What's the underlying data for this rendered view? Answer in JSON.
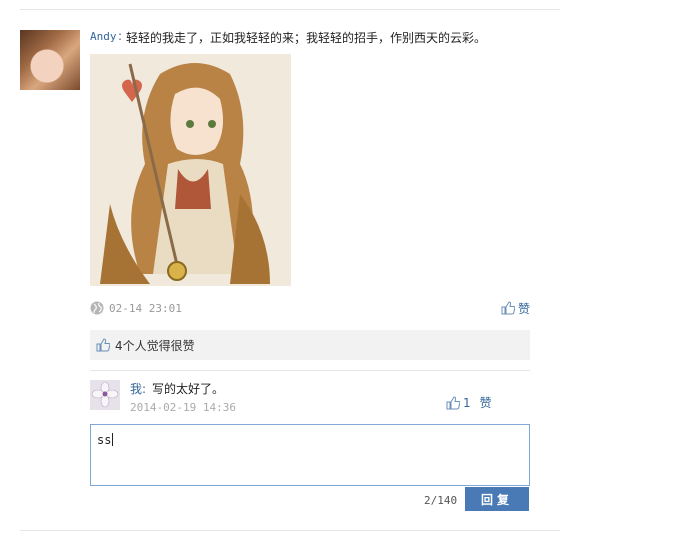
{
  "post": {
    "author": "Andy",
    "separator": ":",
    "text": "轻轻的我走了，正如我轻轻的来；我轻轻的招手，作别西天的云彩。",
    "time": "02-14 23:01",
    "like_label": "赞",
    "likes_summary": "4个人觉得很赞"
  },
  "reply": {
    "author": "我",
    "separator": ":",
    "text": "写的太好了。",
    "time": "2014-02-19 14:36",
    "like_count": "1",
    "like_label": "赞"
  },
  "composer": {
    "value": "ss",
    "counter": "2/140",
    "submit_label": "回复"
  },
  "colors": {
    "link": "#336699",
    "button": "#4a7ab5",
    "input_border": "#7fa8d6"
  },
  "icons": [
    "globe-icon",
    "thumbs-up-icon"
  ]
}
